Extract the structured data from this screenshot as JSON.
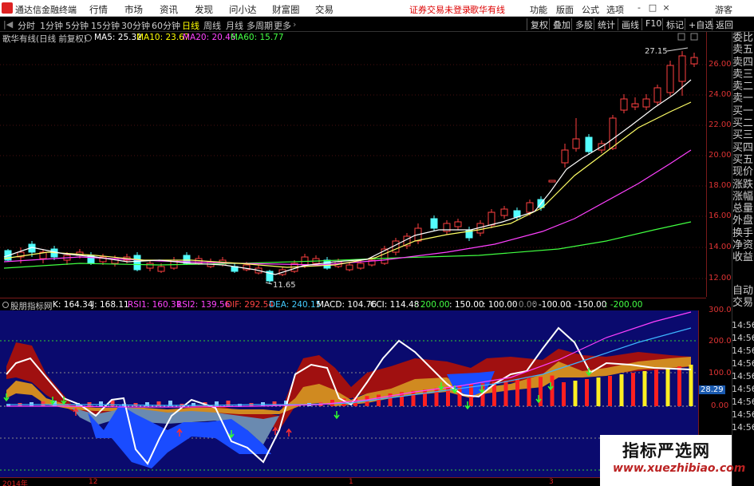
{
  "app": {
    "title": "通达信金融终端",
    "menu": [
      "行情",
      "市场",
      "资讯",
      "发现",
      "问小达",
      "财富圈",
      "交易"
    ],
    "status": "证券交易未登录",
    "stock_name_top": "歌华有线",
    "right_menu": [
      "功能",
      "版面",
      "公式",
      "选项",
      "游客"
    ],
    "window_controls": [
      "-",
      "□",
      "×"
    ]
  },
  "toolbar": {
    "periods": [
      "分时",
      "1分钟",
      "5分钟",
      "15分钟",
      "30分钟",
      "60分钟",
      "日线",
      "周线",
      "月线",
      "多周期",
      "更多"
    ],
    "active_period": "日线",
    "buttons": [
      "复权",
      "叠加",
      "多股",
      "统计",
      "画线",
      "F10",
      "标记",
      "+自选",
      "返回"
    ]
  },
  "side_panel": {
    "items": [
      "委比",
      "卖五",
      "卖四",
      "卖三",
      "卖二",
      "卖一",
      "买一",
      "买二",
      "买三",
      "买四",
      "买五",
      "现价",
      "涨跌",
      "涨幅",
      "总量",
      "外盘",
      "换手",
      "净资",
      "收益",
      "自动",
      "交易"
    ]
  },
  "main_chart": {
    "stock_title": "歌华有线(日线 前复权)",
    "ma": [
      {
        "label": "MA5: 25.32",
        "color": "#ffffff"
      },
      {
        "label": "MA10: 23.67",
        "color": "#ffff00"
      },
      {
        "label": "MA20: 20.46",
        "color": "#ff40ff"
      },
      {
        "label": "MA60: 15.77",
        "color": "#40ff40"
      }
    ],
    "high_label": "27.15",
    "low_label": "11.65",
    "price_ticks": [
      "26.00",
      "24.00",
      "22.00",
      "20.00",
      "18.00",
      "16.00",
      "14.00",
      "12.00"
    ]
  },
  "indicator": {
    "name": "股朋指标网",
    "labels": [
      {
        "text": "K: 164.34",
        "color": "#ffffff"
      },
      {
        "text": "J: 168.11",
        "color": "#ffffff"
      },
      {
        "text": "RSI1: 160.31",
        "color": "#ff40ff"
      },
      {
        "text": "RSI2: 139.56",
        "color": "#ff40ff"
      },
      {
        "text": "DIF: 292.54",
        "color": "#ff4040"
      },
      {
        "text": "DEA: 240.15",
        "color": "#40c0ff"
      },
      {
        "text": "MACD: 104.76",
        "color": "#ffffff"
      },
      {
        "text": "CCI: 114.48",
        "color": "#ffffff"
      },
      {
        "text": ": 200.00",
        "color": "#40ff40"
      },
      {
        "text": ": 150.00",
        "color": "#ffffff"
      },
      {
        "text": ": 100.00",
        "color": "#ffffff"
      },
      {
        "text": ": 0.00",
        "color": "#808080"
      },
      {
        "text": ": -100.00",
        "color": "#ffffff"
      },
      {
        "text": ": -150.00",
        "color": "#ffffff"
      },
      {
        "text": ": -200.00",
        "color": "#40ff40"
      }
    ],
    "axis_ticks": [
      "300.0",
      "200.0",
      "100.0",
      "0.00"
    ],
    "axis_side": [
      "14:56",
      "14:56",
      "14:56",
      "14:56",
      "14:56",
      "14:56",
      "14:56",
      "14:56",
      "14:56"
    ],
    "current_value": "28.29"
  },
  "dates": [
    "2014年",
    "12",
    "1",
    "3"
  ],
  "watermark": {
    "title": "指标严选网",
    "url": "www.xuezhibiao.com"
  }
}
